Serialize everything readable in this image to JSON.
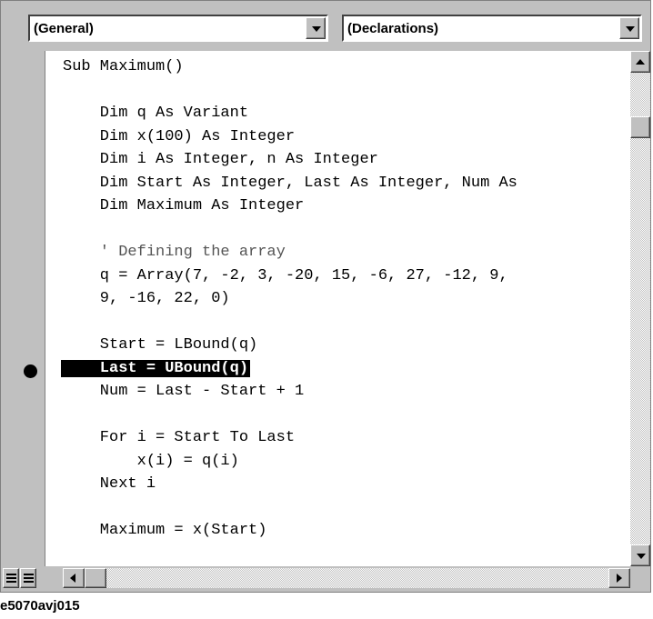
{
  "combos": {
    "object": "(General)",
    "procedure": "(Declarations)"
  },
  "code_lines": [
    "Sub Maximum()",
    "",
    "    Dim q As Variant",
    "    Dim x(100) As Integer",
    "    Dim i As Integer, n As Integer",
    "    Dim Start As Integer, Last As Integer, Num As",
    "    Dim Maximum As Integer",
    "",
    "    ' Defining the array",
    "    q = Array(7, -2, 3, -20, 15, -6, 27, -12, 9,",
    "    9, -16, 22, 0)",
    "",
    "    Start = LBound(q)",
    "    Last = UBound(q)",
    "    Num = Last - Start + 1",
    "",
    "    For i = Start To Last",
    "        x(i) = q(i)",
    "    Next i",
    "",
    "    Maximum = x(Start)"
  ],
  "highlighted_line_index": 13,
  "highlighted_text": "Last = UBound(q)",
  "highlight_indent": "    ",
  "caption": "e5070avj015",
  "icons": [
    "chevron-down-icon",
    "breakpoint-icon",
    "procedure-view-icon",
    "full-module-view-icon",
    "scroll-up-icon",
    "scroll-down-icon",
    "scroll-left-icon",
    "scroll-right-icon"
  ]
}
